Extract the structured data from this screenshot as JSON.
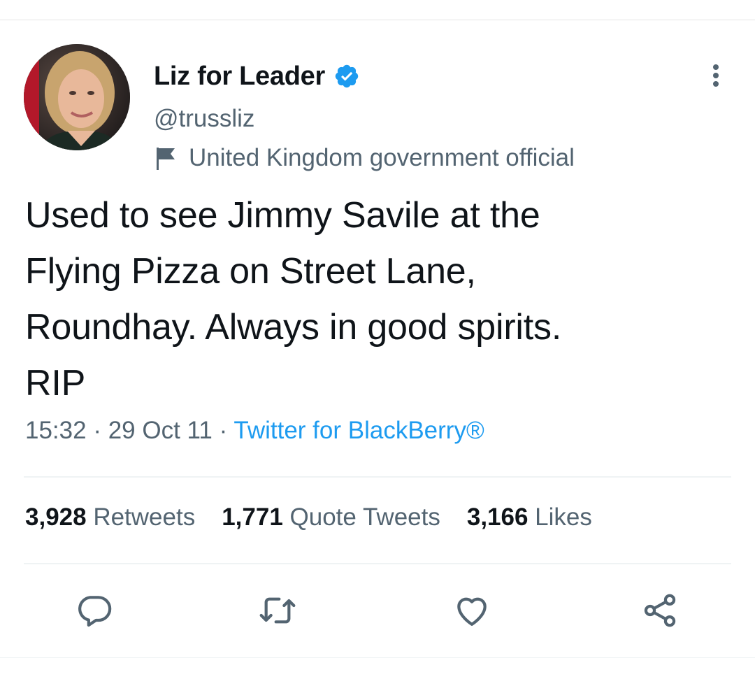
{
  "tweet": {
    "display_name": "Liz for Leader",
    "handle": "@trussliz",
    "account_label": "United Kingdom government official",
    "text_lines": [
      "Used to see Jimmy Savile at the",
      "Flying Pizza on Street Lane,",
      "Roundhay. Always in good spirits.",
      "RIP"
    ],
    "time": "15:32",
    "date": "29 Oct 11",
    "separator": "·",
    "source": "Twitter for BlackBerry®"
  },
  "stats": {
    "retweets_count": "3,928",
    "retweets_label": "Retweets",
    "quotes_count": "1,771",
    "quotes_label": "Quote Tweets",
    "likes_count": "3,166",
    "likes_label": "Likes"
  },
  "icons": {
    "verified": "verified-badge-icon",
    "label": "flag-icon",
    "more": "more-options-icon",
    "reply": "reply-icon",
    "retweet": "retweet-icon",
    "like": "heart-icon",
    "share": "share-icon"
  },
  "colors": {
    "accent": "#1d9bf0",
    "text": "#0f1419",
    "secondary": "#536471"
  }
}
